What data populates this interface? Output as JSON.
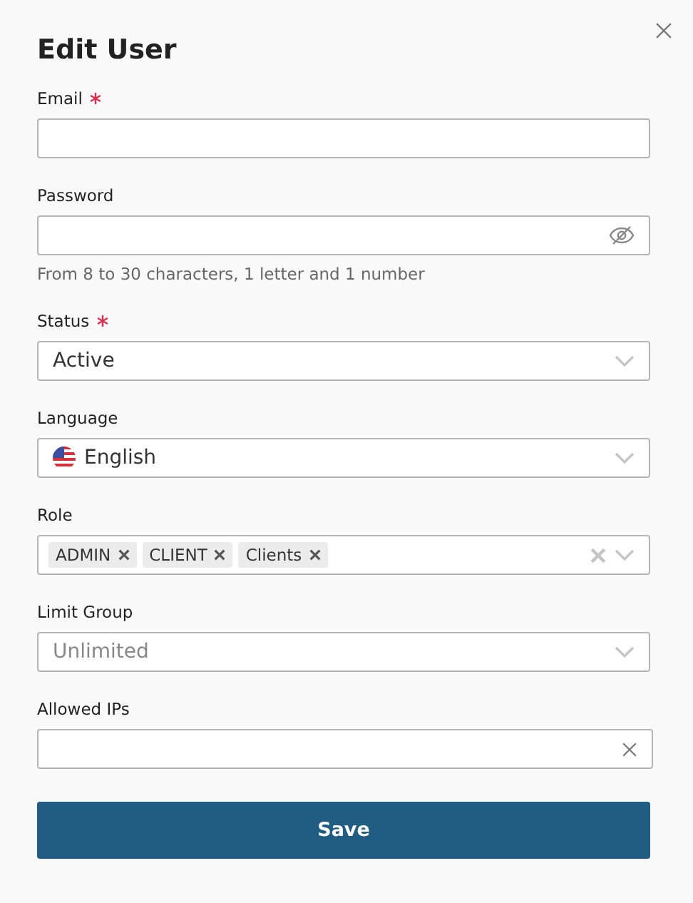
{
  "dialog": {
    "title": "Edit User"
  },
  "fields": [
    {
      "kind": "text",
      "label": "Email",
      "required": true
    },
    {
      "kind": "password",
      "label": "Password",
      "required": false,
      "hint": "From 8 to 30 characters, 1 letter and 1 number"
    },
    {
      "kind": "select",
      "label": "Status",
      "required": true,
      "value": "Active"
    },
    {
      "kind": "language",
      "label": "Language",
      "required": false,
      "value": "English"
    },
    {
      "kind": "tags",
      "label": "Role",
      "required": false,
      "tags": [
        "ADMIN",
        "CLIENT",
        "Clients"
      ]
    },
    {
      "kind": "select",
      "label": "Limit Group",
      "required": false,
      "placeholder": "Unlimited"
    },
    {
      "kind": "clearable",
      "label": "Allowed IPs",
      "required": false
    }
  ],
  "save_button": "Save"
}
